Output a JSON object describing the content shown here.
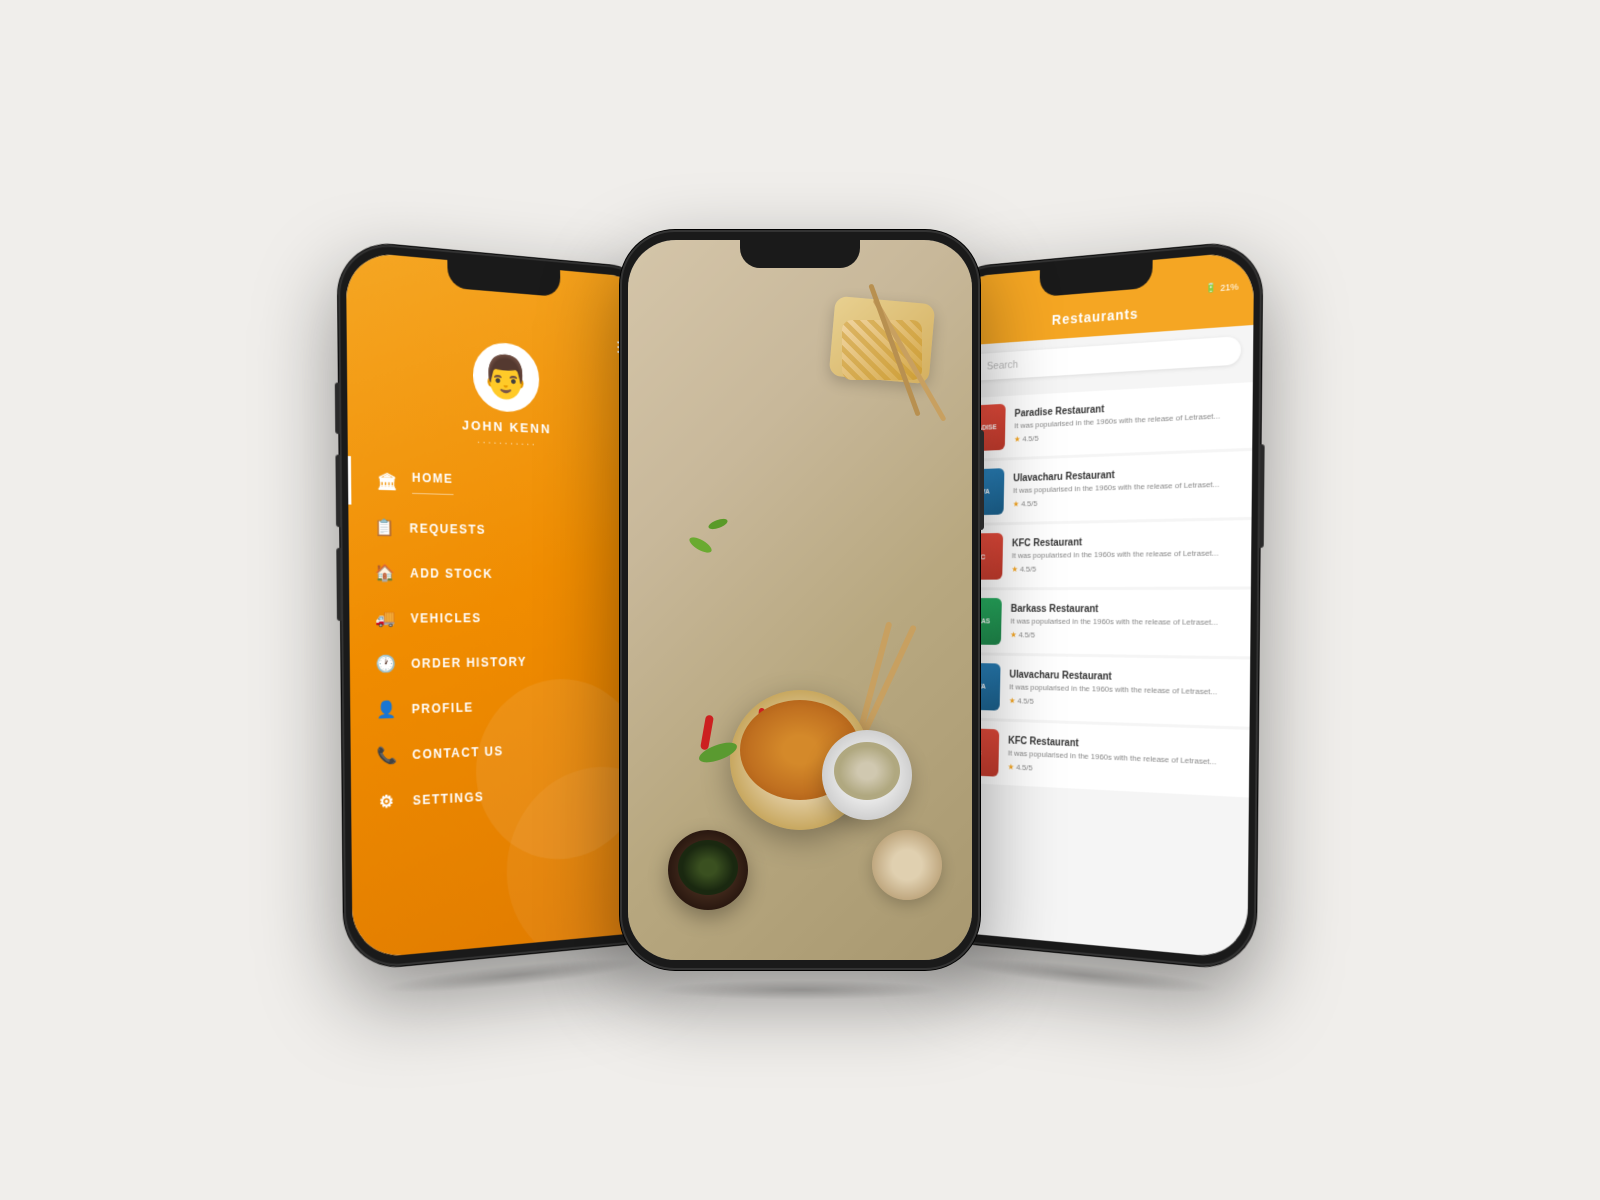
{
  "background": "#f0eeeb",
  "phones": {
    "left": {
      "user": {
        "name": "JOHN KENN",
        "dots": "..........."
      },
      "menu_items": [
        {
          "label": "HOME",
          "icon": "🏛",
          "active": true
        },
        {
          "label": "REQUESTS",
          "icon": "📅",
          "active": false
        },
        {
          "label": "ADD STOCK",
          "icon": "🏠",
          "active": false
        },
        {
          "label": "VEHICLES",
          "icon": "🚚",
          "active": false
        },
        {
          "label": "ORDER HISTORY",
          "icon": "🕐",
          "active": false
        },
        {
          "label": "PROFILE",
          "icon": "👤",
          "active": false
        },
        {
          "label": "CONTACT US",
          "icon": "📞",
          "active": false
        },
        {
          "label": "SETTINGS",
          "icon": "⚙",
          "active": false
        }
      ]
    },
    "center": {
      "description": "Food photography display"
    },
    "right": {
      "header": {
        "title": "Restaurants",
        "back_icon": "←",
        "status": "21%"
      },
      "search": {
        "placeholder": "Search"
      },
      "restaurants": [
        {
          "name": "Paradise Restaurant",
          "description": "It was popularised in the 1960s with the release of Letraset...",
          "rating": "4.5/5",
          "thumb_type": "paradise",
          "thumb_label": "Paradise"
        },
        {
          "name": "Ulavacharu Restaurant",
          "description": "It was popularised in the 1960s with the release of Letraset...",
          "rating": "4.5/5",
          "thumb_type": "blue",
          "thumb_label": "Ulava"
        },
        {
          "name": "KFC Restaurant",
          "description": "It was popularised in the 1960s with the release of Letraset...",
          "rating": "4.5/5",
          "thumb_type": "kfc",
          "thumb_label": "KFC"
        },
        {
          "name": "Barkass Restaurant",
          "description": "It was popularised in the 1960s with the release of Letraset...",
          "rating": "4.5/5",
          "thumb_type": "barkass",
          "thumb_label": "Barkas"
        },
        {
          "name": "Ulavacharu Restaurant",
          "description": "It was popularised in the 1960s with the release of Letraset...",
          "rating": "4.5/5",
          "thumb_type": "blue",
          "thumb_label": "Ulava"
        },
        {
          "name": "KFC Restaurant",
          "description": "It was popularised in the 1960s with the release of Letraset...",
          "rating": "4.5/5",
          "thumb_type": "kfc",
          "thumb_label": "KFC"
        }
      ]
    }
  }
}
